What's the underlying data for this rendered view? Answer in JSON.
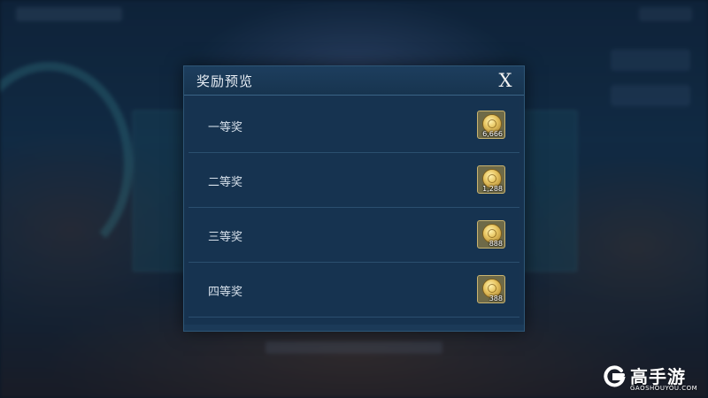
{
  "dialog": {
    "title": "奖励预览",
    "close_label": "X"
  },
  "rewards": [
    {
      "label": "一等奖",
      "icon": "gold-coin-icon",
      "count": "6,666"
    },
    {
      "label": "二等奖",
      "icon": "gold-coin-icon",
      "count": "1,288"
    },
    {
      "label": "三等奖",
      "icon": "gold-coin-icon",
      "count": "888"
    },
    {
      "label": "四等奖",
      "icon": "gold-coin-icon",
      "count": "388"
    }
  ],
  "watermark": {
    "brand": "高手游",
    "domain": "GAOSHOUYOU.COM"
  },
  "colors": {
    "dialog_bg": "#173350",
    "reward_border": "#c9b470"
  }
}
